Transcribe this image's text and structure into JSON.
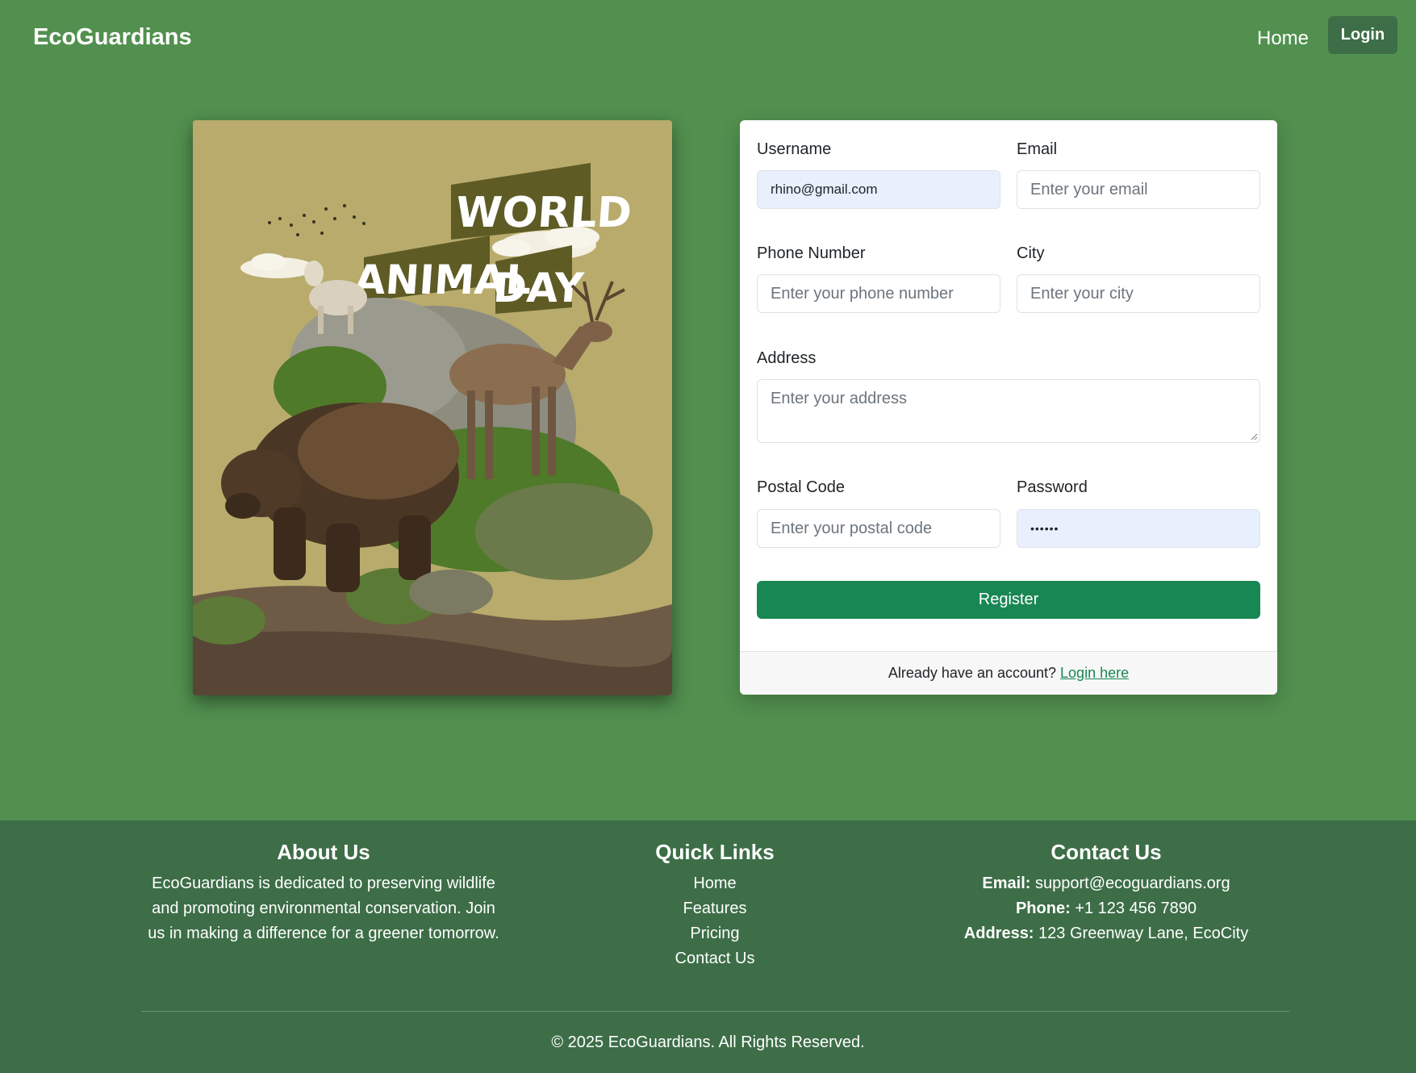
{
  "navbar": {
    "brand": "EcoGuardians",
    "home": "Home",
    "login": "Login"
  },
  "poster": {
    "headline_1": "WORLD",
    "headline_2": "ANIMAL",
    "headline_3": "DAY"
  },
  "form": {
    "username": {
      "label": "Username",
      "value": "rhino@gmail.com"
    },
    "email": {
      "label": "Email",
      "placeholder": "Enter your email"
    },
    "phone": {
      "label": "Phone Number",
      "placeholder": "Enter your phone number"
    },
    "city": {
      "label": "City",
      "placeholder": "Enter your city"
    },
    "address": {
      "label": "Address",
      "placeholder": "Enter your address"
    },
    "postal": {
      "label": "Postal Code",
      "placeholder": "Enter your postal code"
    },
    "password": {
      "label": "Password",
      "value": "••••••"
    },
    "register": "Register",
    "footer_text": "Already have an account?",
    "footer_link": "Login here"
  },
  "footer": {
    "about": {
      "title": "About Us",
      "line1": "EcoGuardians is dedicated to preserving wildlife",
      "line2": "and promoting environmental conservation. Join",
      "line3": "us in making a difference for a greener tomorrow."
    },
    "links": {
      "title": "Quick Links",
      "items": [
        "Home",
        "Features",
        "Pricing",
        "Contact Us"
      ]
    },
    "contact": {
      "title": "Contact Us",
      "email_label": "Email:",
      "email": "support@ecoguardians.org",
      "phone_label": "Phone:",
      "phone": "+1 123 456 7890",
      "address_label": "Address:",
      "address": "123 Greenway Lane, EcoCity"
    },
    "copyright": "© 2025 EcoGuardians. All Rights Reserved."
  },
  "colors": {
    "page_bg": "#52904f",
    "footer_bg": "#3d6e47",
    "primary_button": "#198754",
    "autofill_bg": "#e8f0fe"
  }
}
